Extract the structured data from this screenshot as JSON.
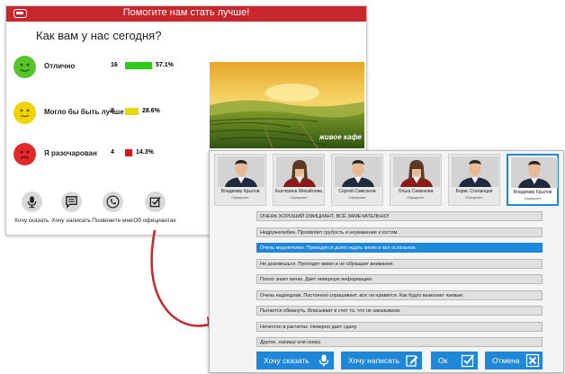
{
  "survey": {
    "header_title": "Помогите нам стать лучше!",
    "question": "Как вам у нас сегодня?",
    "ratings": [
      {
        "label": "Отлично",
        "count": "16",
        "percent": "57.1%",
        "fraction": 0.571,
        "color": "#2ecc1a",
        "face": "happy"
      },
      {
        "label": "Могло бы быть лучше",
        "count": "8",
        "percent": "28.6%",
        "fraction": 0.286,
        "color": "#e8d800",
        "face": "neutral"
      },
      {
        "label": "Я разочарован",
        "count": "4",
        "percent": "14.3%",
        "fraction": 0.143,
        "color": "#d8151c",
        "face": "sad"
      }
    ],
    "brand": "живое кафе",
    "actions": [
      {
        "label": "Хочу сказать",
        "icon": "microphone-icon"
      },
      {
        "label": "Хочу написать",
        "icon": "message-icon"
      },
      {
        "label": "Позвоните мне",
        "icon": "phone-icon"
      },
      {
        "label": "Об официантах",
        "icon": "checkbox-icon"
      }
    ]
  },
  "dialog": {
    "waiters": [
      {
        "name": "Владимир Крылов",
        "role": "Официант",
        "gender": "m"
      },
      {
        "name": "Екатерина Михайлова",
        "role": "Официант",
        "gender": "f"
      },
      {
        "name": "Сергей Самсонов",
        "role": "Официант",
        "gender": "m"
      },
      {
        "name": "Ольга Семенова",
        "role": "Официант",
        "gender": "f"
      },
      {
        "name": "Борис Степанцев",
        "role": "Официант",
        "gender": "m"
      },
      {
        "name": "Владимир Крылов",
        "role": "Официант",
        "gender": "m",
        "selected": true
      }
    ],
    "options": [
      {
        "text": "ОЧЕНЬ ХОРОШИЙ ОФИЦИАНТ. ВСЁ ЗАМЕЧАТЕЛЬНО!"
      },
      {
        "text": "Недружелюбен. Проявляет грубость и неуважение к гостям."
      },
      {
        "text": "Очень медлителен. Приходится долго ждать меню и все остальное.",
        "selected": true
      },
      {
        "text": "Не дозовешься. Проходит мимо и не обращает внимания."
      },
      {
        "text": "Плохо знает меню. Дает неверную информацию."
      },
      {
        "text": "Очень надоедлив. Постоянно спрашивает, все ли нравится.  Как будто вымогает чаевые."
      },
      {
        "text": "Пытается обмануть. Вписывает в счет то, что не заказывали."
      },
      {
        "text": "Нечестен в расчетах. Неверно дает сдачу."
      },
      {
        "text": "Другое, напишу или скажу."
      }
    ],
    "buttons": {
      "speak": "Хочу сказать",
      "write": "Хочу написать",
      "ok": "Ок",
      "cancel": "Отмена"
    }
  },
  "colors": {
    "accent_red": "#c8262d",
    "accent_blue": "#1e87d7"
  }
}
